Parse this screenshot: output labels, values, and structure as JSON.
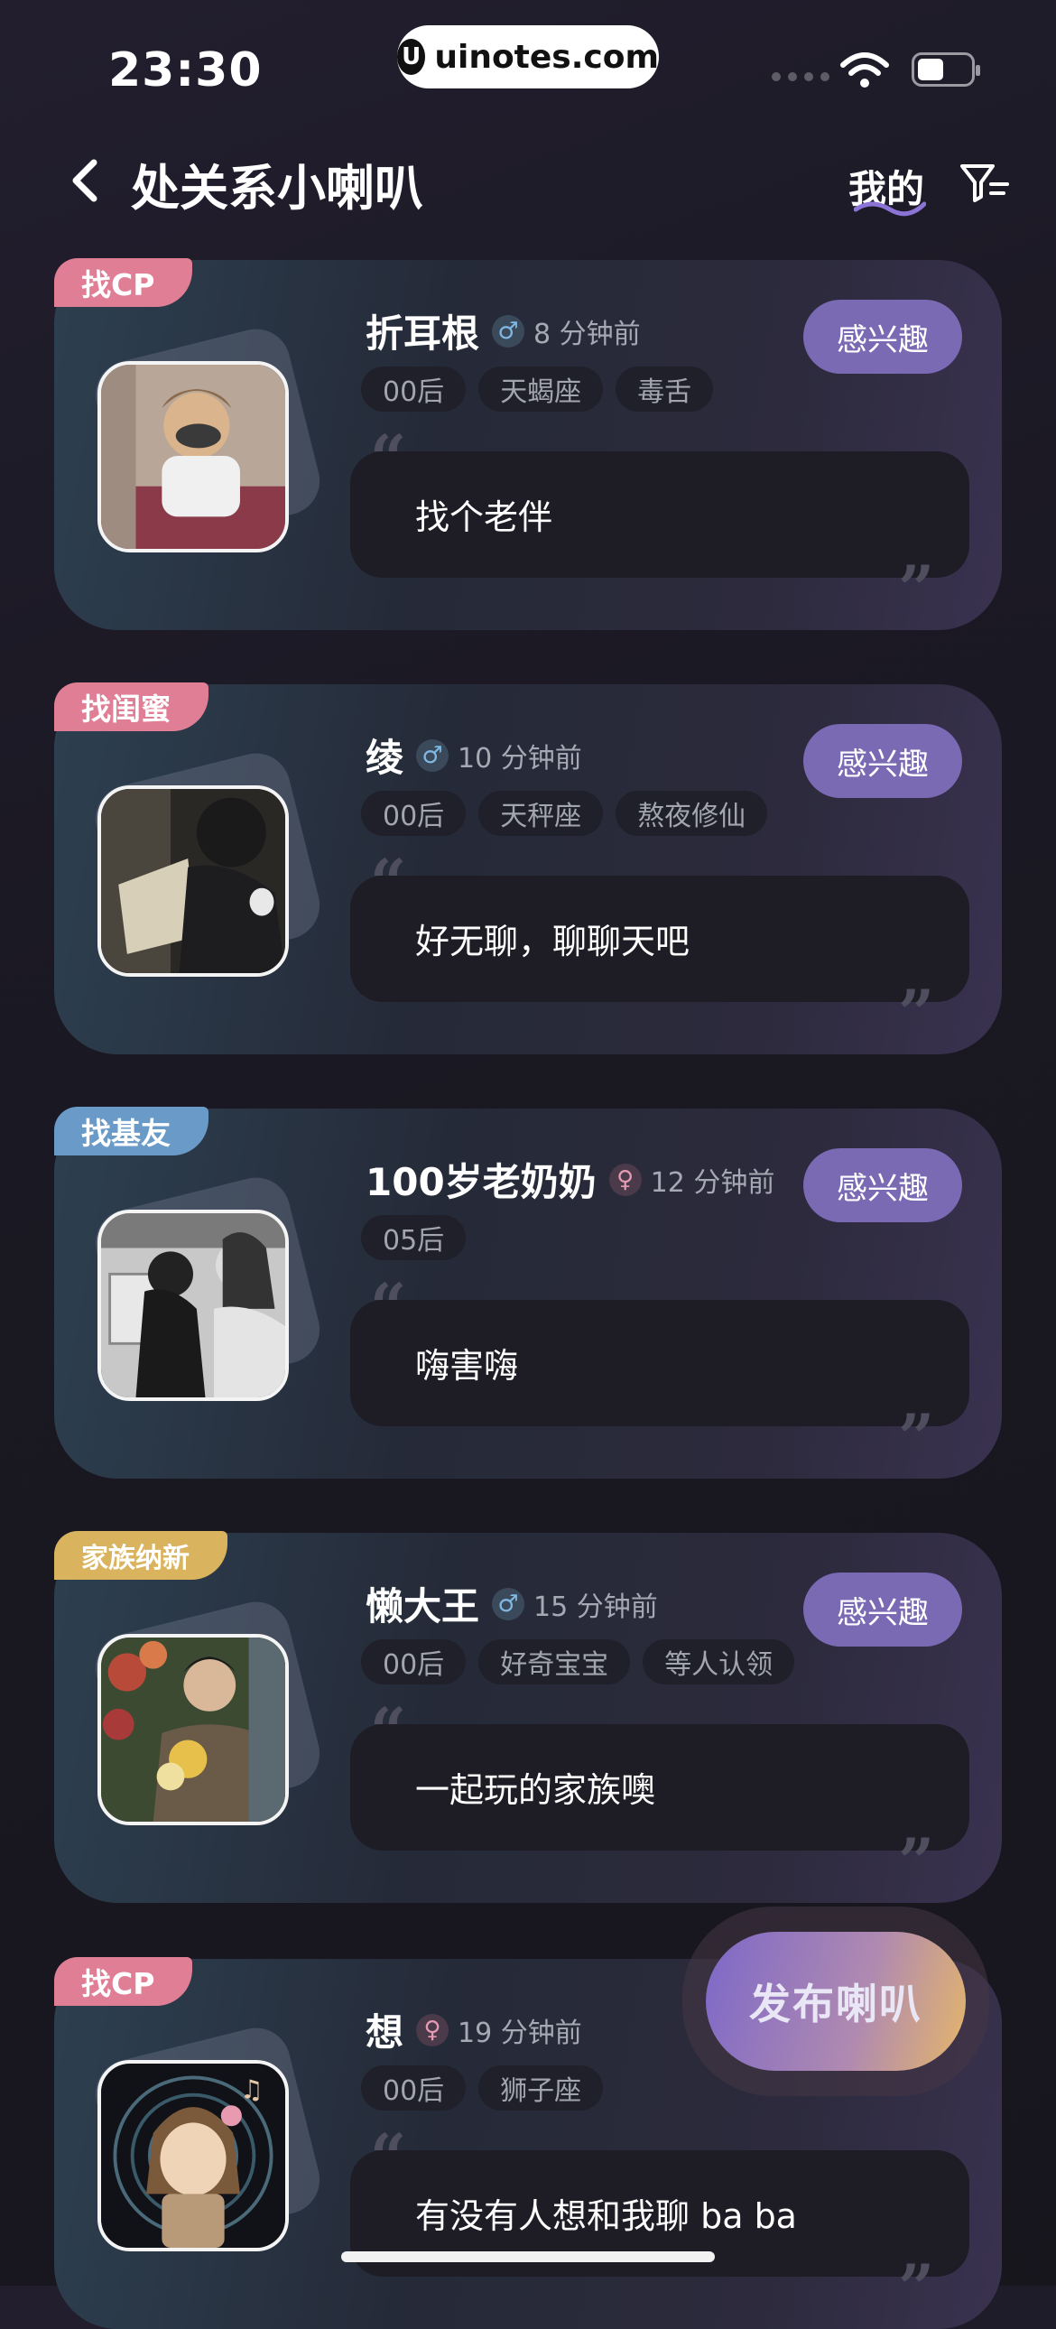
{
  "status": {
    "time": "23:30",
    "watermark": "uinotes.com",
    "watermark_logo": "U"
  },
  "nav": {
    "back_icon": "chevron-left-icon",
    "title": "处关系小喇叭",
    "mine_label": "我的",
    "filter_icon": "filter-icon"
  },
  "interest_label": "感兴趣",
  "quote_open": "“",
  "quote_close": "”",
  "cards": [
    {
      "tag": "找CP",
      "tag_color": "#e07e95",
      "name": "折耳根",
      "gender_symbol": "♂",
      "ago": "8 分钟前",
      "pills": [
        "00后",
        "天蝎座",
        "毒舌"
      ],
      "quote": "找个老伴"
    },
    {
      "tag": "找闺蜜",
      "tag_color": "#e07e95",
      "name": "绫",
      "gender_symbol": "♂",
      "ago": "10 分钟前",
      "pills": [
        "00后",
        "天秤座",
        "熬夜修仙"
      ],
      "quote": "好无聊，聊聊天吧"
    },
    {
      "tag": "找基友",
      "tag_color": "#6a9ac8",
      "name": "100岁老奶奶",
      "gender_symbol": "♀",
      "ago": "12 分钟前",
      "pills": [
        "05后"
      ],
      "quote": "嗨害嗨"
    },
    {
      "tag": "家族纳新",
      "tag_color": "#d9b35e",
      "name": "懒大王",
      "gender_symbol": "♂",
      "ago": "15 分钟前",
      "pills": [
        "00后",
        "好奇宝宝",
        "等人认领"
      ],
      "quote": "一起玩的家族噢"
    },
    {
      "tag": "找CP",
      "tag_color": "#e07e95",
      "name": "想",
      "gender_symbol": "♀",
      "ago": "19 分钟前",
      "pills": [
        "00后",
        "狮子座"
      ],
      "quote": "有没有人想和我聊 ba ba"
    }
  ],
  "fab_label": "发布喇叭"
}
